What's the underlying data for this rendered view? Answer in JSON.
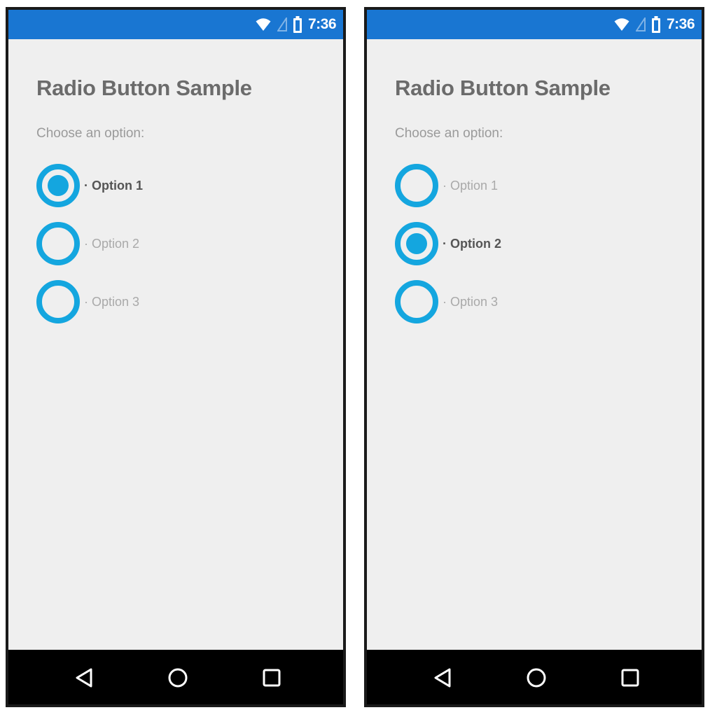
{
  "phones": [
    {
      "status_bar": {
        "time": "7:36"
      },
      "app": {
        "title": "Radio Button Sample",
        "prompt": "Choose an option:",
        "options": [
          {
            "label": "· Option 1",
            "selected": true
          },
          {
            "label": "· Option 2",
            "selected": false
          },
          {
            "label": "· Option 3",
            "selected": false
          }
        ]
      }
    },
    {
      "status_bar": {
        "time": "7:36"
      },
      "app": {
        "title": "Radio Button Sample",
        "prompt": "Choose an option:",
        "options": [
          {
            "label": "· Option 1",
            "selected": false
          },
          {
            "label": "· Option 2",
            "selected": true
          },
          {
            "label": "· Option 3",
            "selected": false
          }
        ]
      }
    }
  ],
  "colors": {
    "status_bar": "#1976d2",
    "accent": "#14a6df",
    "background": "#efefef",
    "nav_bar": "#000000"
  },
  "icons": {
    "status": [
      "wifi-icon",
      "signal-icon",
      "battery-icon"
    ],
    "nav": [
      "back-icon",
      "home-icon",
      "recents-icon"
    ]
  }
}
